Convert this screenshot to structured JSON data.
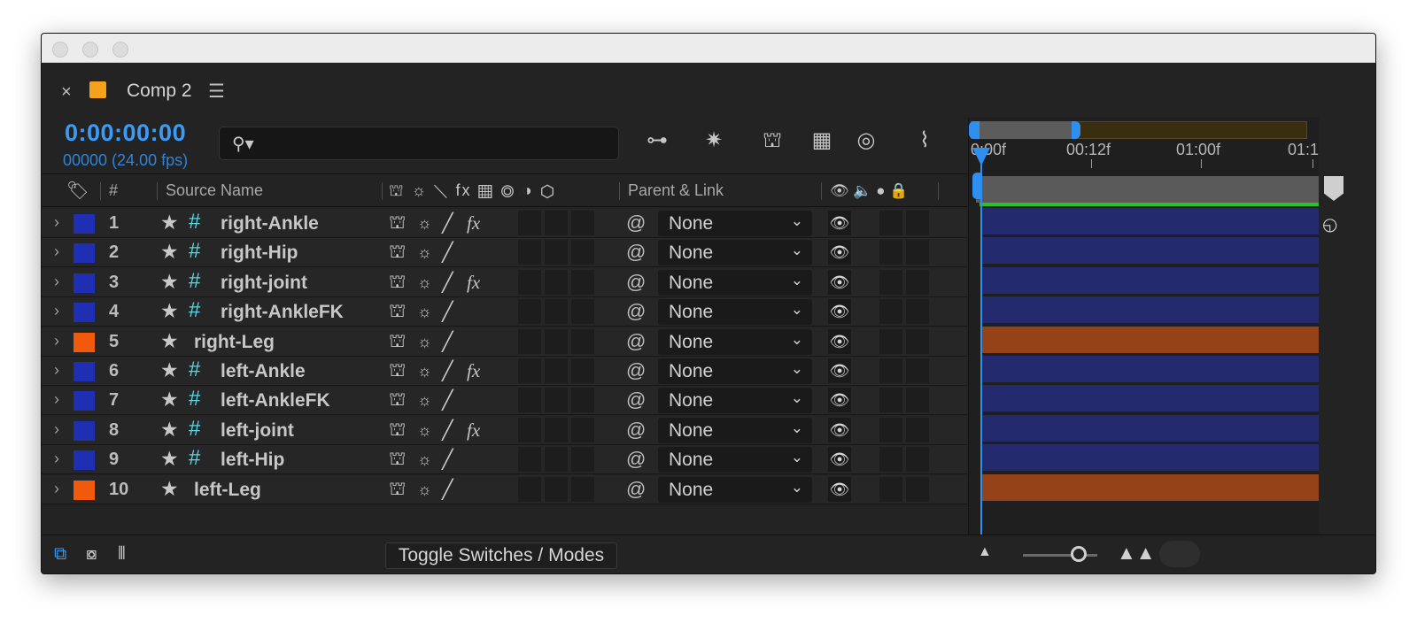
{
  "tab": {
    "close": "×",
    "title": "Comp 2",
    "menu": "☰"
  },
  "time": {
    "timecode": "0:00:00:00",
    "frames": "00000 (24.00 fps)"
  },
  "search": {
    "icon": "⚲▾",
    "placeholder": ""
  },
  "toolbar": {
    "icons": [
      "composition-flowchart-icon",
      "draft-3d-icon",
      "shy-layers-icon",
      "frame-blending-icon",
      "motion-blur-icon",
      "graph-editor-icon"
    ],
    "glyphs": [
      "⊶",
      "✷",
      "⛫",
      "▦",
      "◎",
      "⌇"
    ]
  },
  "columns": {
    "label": "🏷",
    "num": "#",
    "source_name": "Source Name",
    "switches": "⛫ ☼ ⟍ fx ▦ ◎ ◑ ⬡",
    "parent_link": "Parent & Link",
    "av": "👁 🔈 ● 🔒"
  },
  "layers": [
    {
      "num": "1",
      "name": "right-Ankle",
      "color": "#1f2fb4",
      "hash": true,
      "fx": true,
      "bar": "#232a6e"
    },
    {
      "num": "2",
      "name": "right-Hip",
      "color": "#1f2fb4",
      "hash": true,
      "fx": false,
      "bar": "#232a6e"
    },
    {
      "num": "3",
      "name": "right-joint",
      "color": "#1f2fb4",
      "hash": true,
      "fx": true,
      "bar": "#232a6e"
    },
    {
      "num": "4",
      "name": "right-AnkleFK",
      "color": "#1f2fb4",
      "hash": true,
      "fx": false,
      "bar": "#232a6e"
    },
    {
      "num": "5",
      "name": "right-Leg",
      "color": "#f05a0a",
      "hash": false,
      "fx": false,
      "bar": "#954219"
    },
    {
      "num": "6",
      "name": "left-Ankle",
      "color": "#1f2fb4",
      "hash": true,
      "fx": true,
      "bar": "#232a6e"
    },
    {
      "num": "7",
      "name": "left-AnkleFK",
      "color": "#1f2fb4",
      "hash": true,
      "fx": false,
      "bar": "#232a6e"
    },
    {
      "num": "8",
      "name": "left-joint",
      "color": "#1f2fb4",
      "hash": true,
      "fx": true,
      "bar": "#232a6e"
    },
    {
      "num": "9",
      "name": "left-Hip",
      "color": "#1f2fb4",
      "hash": true,
      "fx": false,
      "bar": "#232a6e"
    },
    {
      "num": "10",
      "name": "left-Leg",
      "color": "#f05a0a",
      "hash": false,
      "fx": false,
      "bar": "#954219"
    }
  ],
  "parent_value": "None",
  "ruler": {
    "labels": [
      "0:00f",
      "00:12f",
      "01:00f",
      "01:1"
    ]
  },
  "bottom": {
    "toggle": "Toggle Switches / Modes"
  },
  "colors": {
    "accent": "#3b9bf6",
    "work_area_end": "#2ac12a"
  }
}
